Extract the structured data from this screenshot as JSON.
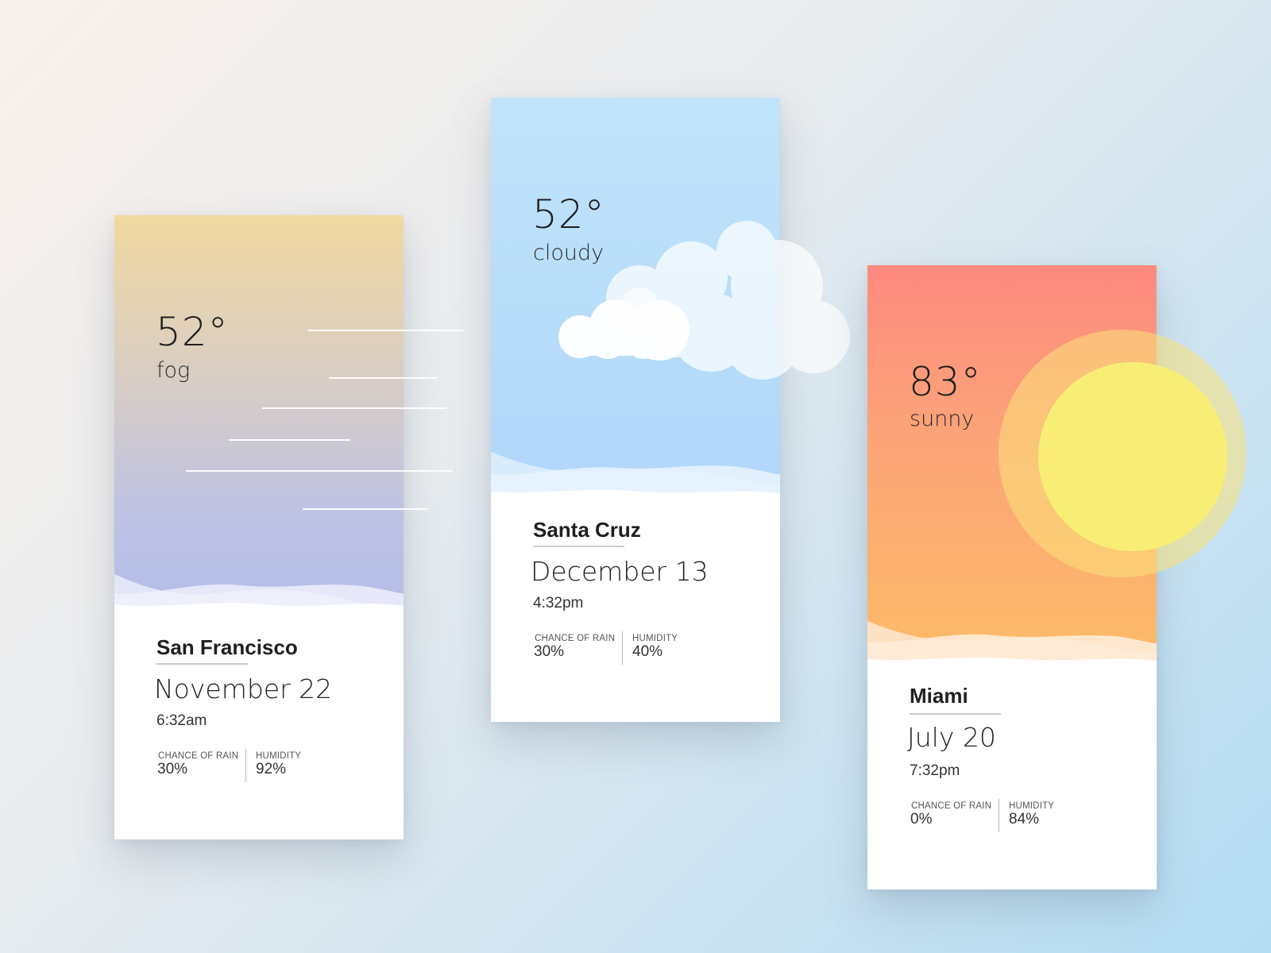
{
  "cards": {
    "sf": {
      "temperature": "52°",
      "condition": "fog",
      "city": "San Francisco",
      "date": "November 22",
      "time": "6:32am",
      "stats": {
        "rain_label": "CHANCE OF RAIN",
        "rain_value": "30%",
        "humidity_label": "HUMIDITY",
        "humidity_value": "92%"
      },
      "sky_colors": [
        "#f2d9a0",
        "#d4ccc8",
        "#b7bfe8"
      ],
      "weather_icon": "fog-lines-icon"
    },
    "santacruz": {
      "temperature": "52°",
      "condition": "cloudy",
      "city": "Santa Cruz",
      "date": "December 13",
      "time": "4:32pm",
      "stats": {
        "rain_label": "CHANCE OF RAIN",
        "rain_value": "30%",
        "humidity_label": "HUMIDITY",
        "humidity_value": "40%"
      },
      "sky_colors": [
        "#c1e3fa",
        "#b1d6fa"
      ],
      "weather_icon": "cloud-icon"
    },
    "miami": {
      "temperature": "83°",
      "condition": "sunny",
      "city": "Miami",
      "date": "July 20",
      "time": "7:32pm",
      "stats": {
        "rain_label": "CHANCE OF RAIN",
        "rain_value": "0%",
        "humidity_label": "HUMIDITY",
        "humidity_value": "84%"
      },
      "sky_colors": [
        "#fd8a80",
        "#fca97a",
        "#fdbf67"
      ],
      "weather_icon": "sun-icon"
    }
  }
}
